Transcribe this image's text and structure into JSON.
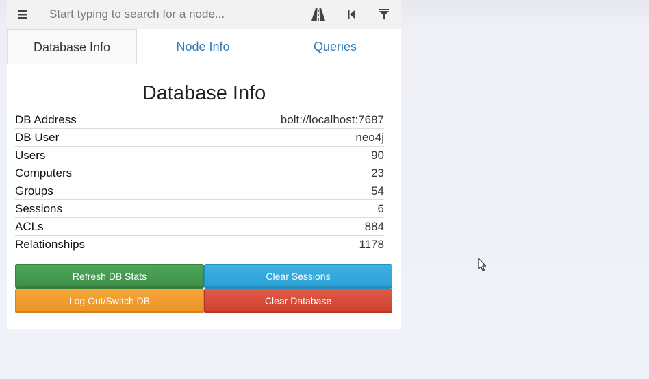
{
  "search": {
    "placeholder": "Start typing to search for a node..."
  },
  "icons": {
    "menu": "hamburger-icon",
    "pathfinding": "road-icon",
    "back": "step-backward-icon",
    "filter": "filter-icon"
  },
  "tabs": [
    {
      "label": "Database Info",
      "active": true
    },
    {
      "label": "Node Info",
      "active": false
    },
    {
      "label": "Queries",
      "active": false
    }
  ],
  "main": {
    "title": "Database Info",
    "stats": [
      {
        "label": "DB Address",
        "value": "bolt://localhost:7687"
      },
      {
        "label": "DB User",
        "value": "neo4j"
      },
      {
        "label": "Users",
        "value": "90"
      },
      {
        "label": "Computers",
        "value": "23"
      },
      {
        "label": "Groups",
        "value": "54"
      },
      {
        "label": "Sessions",
        "value": "6"
      },
      {
        "label": "ACLs",
        "value": "884"
      },
      {
        "label": "Relationships",
        "value": "1178"
      }
    ],
    "buttons": {
      "refresh": "Refresh DB Stats",
      "clear_sessions": "Clear Sessions",
      "logout": "Log Out/Switch DB",
      "clear_database": "Clear Database"
    }
  },
  "colors": {
    "tab_link": "#337ab7",
    "green": "#3d8f48",
    "blue": "#2a9fd6",
    "orange": "#ed9223",
    "red": "#cf3f2c"
  }
}
